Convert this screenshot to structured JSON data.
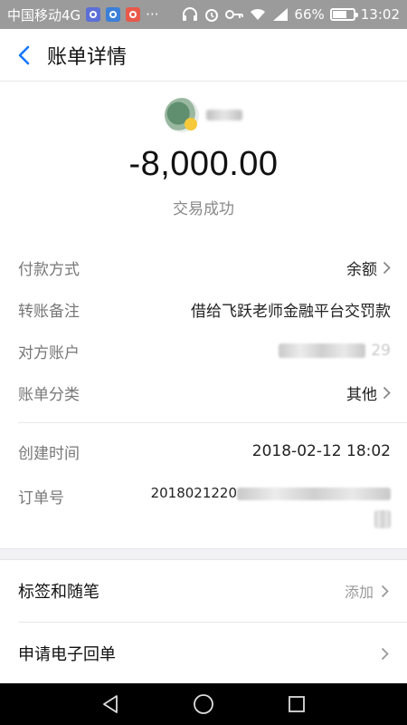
{
  "statusbar": {
    "carrier": "中国移动4G",
    "dots": "···",
    "battery_percent": "66%",
    "time": "13:02"
  },
  "header": {
    "title": "账单详情"
  },
  "transaction": {
    "amount": "-8,000.00",
    "status": "交易成功"
  },
  "details": {
    "payment_method_label": "付款方式",
    "payment_method_value": "余额",
    "remark_label": "转账备注",
    "remark_value": "借给飞跃老师金融平台交罚款",
    "counterparty_label": "对方账户",
    "counterparty_suffix": "29",
    "category_label": "账单分类",
    "category_value": "其他",
    "created_label": "创建时间",
    "created_value": "2018-02-12 18:02",
    "order_label": "订单号",
    "order_prefix": "2018021220"
  },
  "actions": {
    "tags_label": "标签和随笔",
    "tags_action": "添加",
    "receipt_label": "申请电子回单"
  },
  "colors": {
    "accent": "#1677ff",
    "statusbar": "#9b9b9b"
  }
}
